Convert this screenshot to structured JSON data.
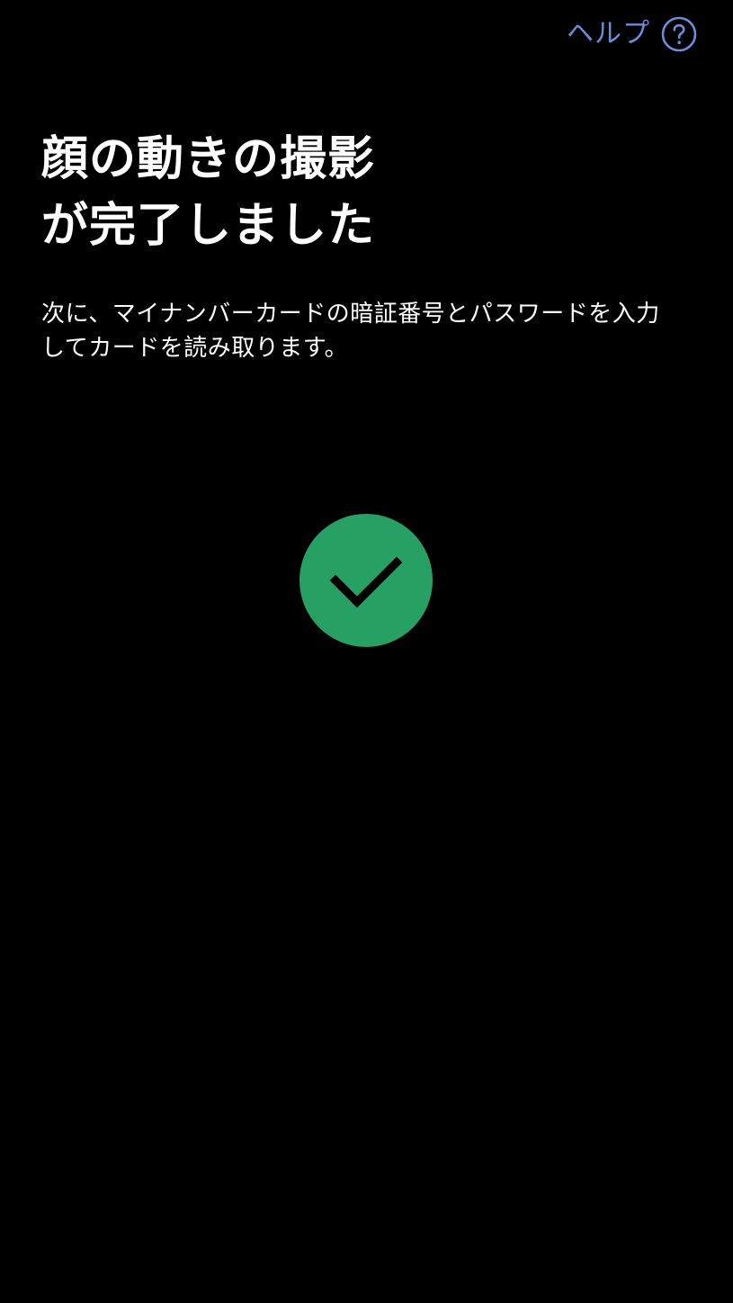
{
  "header": {
    "help_label": "ヘルプ",
    "help_icon": "question-circle-icon",
    "help_color": "#6f8bdb"
  },
  "main": {
    "title_lines": [
      "顔の動きの撮影",
      "が完了しました"
    ],
    "description_lines": [
      "次に、マイナンバーカードの暗証番号とパスワードを入力",
      "してカードを読み取ります。"
    ],
    "status_icon": "checkmark-circle-icon",
    "status_color": "#27a064"
  }
}
